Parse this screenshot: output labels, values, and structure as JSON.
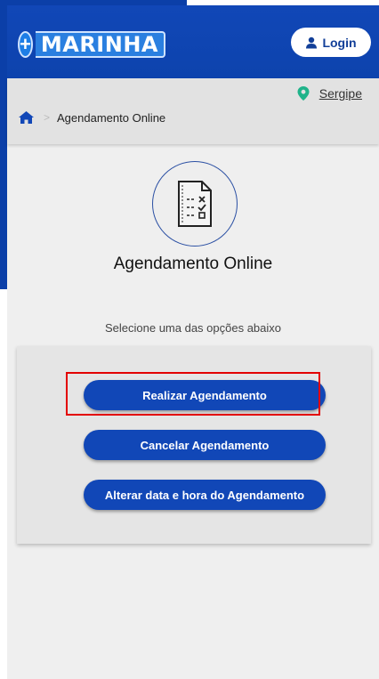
{
  "header": {
    "logo_plus": "+",
    "logo_text": "MARINHA",
    "login_label": "Login"
  },
  "location": {
    "label": "Sergipe"
  },
  "breadcrumb": {
    "current": "Agendamento Online"
  },
  "main": {
    "title": "Agendamento Online",
    "hint": "Selecione uma das opções abaixo"
  },
  "actions": [
    {
      "label": "Realizar Agendamento"
    },
    {
      "label": "Cancelar Agendamento"
    },
    {
      "label": "Alterar data e hora do Agendamento"
    }
  ],
  "colors": {
    "brand_blue": "#1147b7",
    "highlight_red": "#e30000",
    "pin_green": "#1fb38a"
  },
  "icons": [
    "user-icon",
    "pin-icon",
    "home-icon",
    "checklist-document-icon"
  ]
}
